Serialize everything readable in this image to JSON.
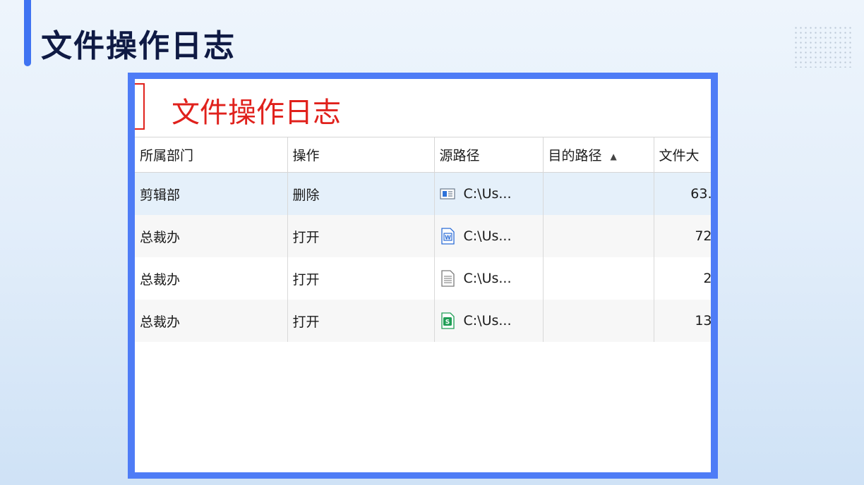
{
  "slide": {
    "title": "文件操作日志"
  },
  "panel": {
    "title": "文件操作日志"
  },
  "table": {
    "columns": [
      "所属部门",
      "操作",
      "源路径",
      "目的路径",
      "文件大"
    ],
    "sorted_column": "目的路径",
    "sort_direction": "ascending",
    "rows": [
      {
        "department": "剪辑部",
        "operation": "删除",
        "file_icon": "generic-window-file-icon",
        "source_path": "C:\\Us...",
        "dest_path": "",
        "file_size": "63."
      },
      {
        "department": "总裁办",
        "operation": "打开",
        "file_icon": "word-document-icon",
        "source_path": "C:\\Us...",
        "dest_path": "",
        "file_size": "72"
      },
      {
        "department": "总裁办",
        "operation": "打开",
        "file_icon": "text-document-icon",
        "source_path": "C:\\Us...",
        "dest_path": "",
        "file_size": "2"
      },
      {
        "department": "总裁办",
        "operation": "打开",
        "file_icon": "spreadsheet-document-icon",
        "source_path": "C:\\Us...",
        "dest_path": "",
        "file_size": "13"
      }
    ]
  },
  "colors": {
    "accent": "#3f73f2",
    "frame": "#4e7cf6",
    "panel_title": "#e0211c",
    "selected_row": "#e5f0fa"
  }
}
